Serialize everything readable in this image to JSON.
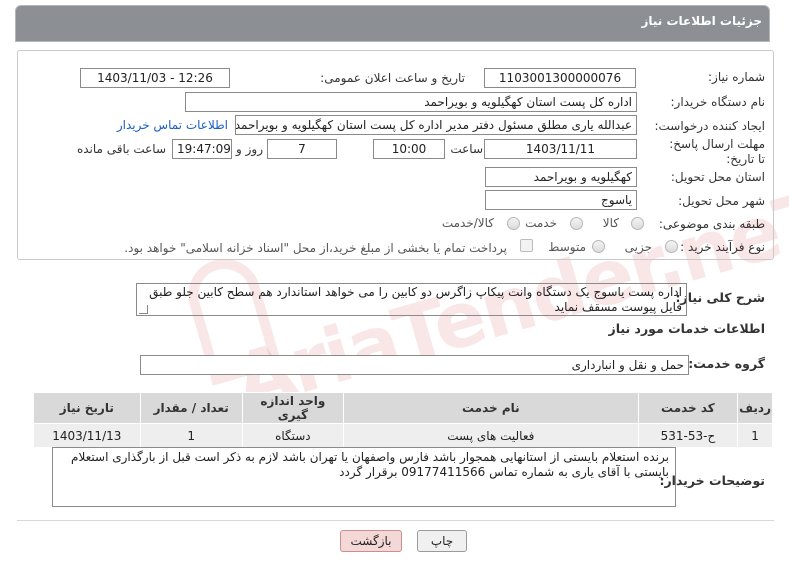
{
  "header": {
    "title": "جزئیات اطلاعات نیاز"
  },
  "labels": {
    "need_number": "شماره نیاز:",
    "announce_datetime": "تاریخ و ساعت اعلان عمومی:",
    "buyer_org": "نام دستگاه خریدار:",
    "requester": "ایجاد کننده درخواست:",
    "deadline": "مهلت ارسال پاسخ: تا تاریخ:",
    "time": "ساعت",
    "day_and": "روز و",
    "remaining": "ساعت باقی مانده",
    "delivery_province": "استان محل تحویل:",
    "delivery_city": "شهر محل تحویل:",
    "category": "طبقه بندی موضوعی:",
    "purchase_type": "نوع فرآیند خرید :",
    "overall_desc": "شرح کلی نیاز:",
    "services_info": "اطلاعات خدمات مورد نیاز",
    "service_group": "گروه خدمت:",
    "buyer_notes": "توضیحات خریدار:"
  },
  "values": {
    "need_number": "1103001300000076",
    "announce_datetime": "1403/11/03 - 12:26",
    "buyer_org": "اداره کل پست استان کهگیلویه و بویراحمد",
    "requester": "عبدالله یاری مطلق مسئول دفتر مدیر اداره کل پست استان کهگیلویه و بویراحمد",
    "buyer_contact_link": "اطلاعات تماس خریدار",
    "deadline_date": "1403/11/11",
    "deadline_time": "10:00",
    "days": "7",
    "remaining_time": "19:47:09",
    "delivery_province": "کهگیلویه و بویراحمد",
    "delivery_city": "یاسوج",
    "overall_desc": "اداره پست یاسوج یک دستگاه وانت پیکاپ زاگرس دو کابین را می خواهد  استاندارد  هم سطح کابین جلو  طبق فایل پیوست  مسقف نماید",
    "service_group": "حمل و نقل و انبارداری",
    "buyer_notes": "برنده استعلام  بایستی از استانهایی همجوار  باشد  فارس واصفهان  یا  تهران باشد   لازم به ذکر است  قبل از بارگذاری استعلام بایستی با آقای یاری  به شماره تماس 09177411566  برقرار گردد"
  },
  "category_options": [
    {
      "label": "کالا",
      "selected": false
    },
    {
      "label": "خدمت",
      "selected": false
    },
    {
      "label": "کالا/خدمت",
      "selected": false
    }
  ],
  "purchase_options": [
    {
      "label": "جزیی",
      "selected": false
    },
    {
      "label": "متوسط",
      "selected": false
    }
  ],
  "payment_note": "پرداخت تمام یا بخشی از مبلغ خرید،از محل \"اسناد خزانه اسلامی\" خواهد بود.",
  "table": {
    "headers": [
      "ردیف",
      "کد خدمت",
      "نام خدمت",
      "واحد اندازه گیری",
      "تعداد / مقدار",
      "تاریخ نیاز"
    ],
    "rows": [
      [
        "1",
        "ح-53-531",
        "فعالیت های پست",
        "دستگاه",
        "1",
        "1403/11/13"
      ]
    ]
  },
  "buttons": {
    "print": "چاپ",
    "back": "بازگشت"
  },
  "watermark": "AriaTender.neT",
  "colors": {
    "header_bg": "#8c8f93",
    "link": "#1a5ec8",
    "back_button_bg": "#f4d8d8"
  }
}
